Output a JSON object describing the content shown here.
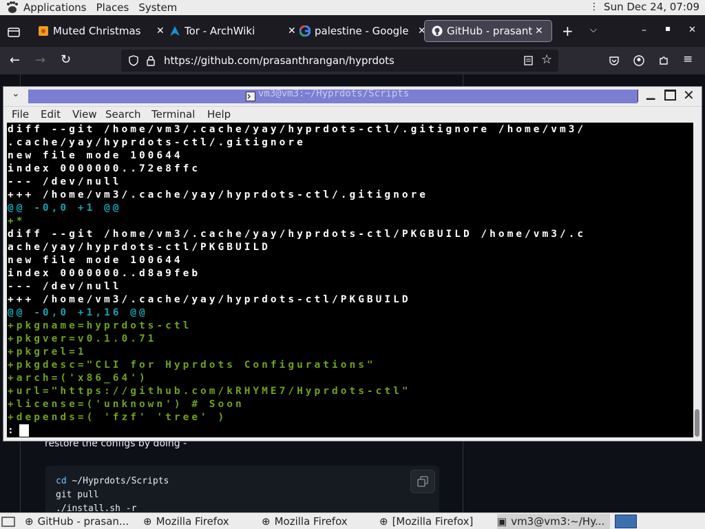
{
  "top_panel": {
    "applications": "Applications",
    "places": "Places",
    "system": "System",
    "clock": "Sun Dec 24, 07:09"
  },
  "browser": {
    "tabs": [
      {
        "label": "Muted Christmas",
        "icon": "christmas-tab-icon"
      },
      {
        "label": "Tor - ArchWiki",
        "icon": "archlinux-icon"
      },
      {
        "label": "palestine - Google",
        "icon": "google-icon"
      },
      {
        "label": "GitHub - prasanth",
        "icon": "github-icon"
      }
    ],
    "url": "https://github.com/prasanthrangan/hyprdots"
  },
  "github_page": {
    "restore_text": "restore the configs by doing -",
    "code_lines": [
      "cd ~/Hyprdots/Scripts",
      "git pull",
      "./install.sh -r"
    ]
  },
  "terminal": {
    "title": "vm3@vm3:~/Hyprdots/Scripts",
    "menu": [
      "File",
      "Edit",
      "View",
      "Search",
      "Terminal",
      "Help"
    ],
    "lines": [
      {
        "text": "diff --git /home/vm3/.cache/yay/hyprdots-ctl/.gitignore /home/vm3/",
        "color": "white"
      },
      {
        "text": ".cache/yay/hyprdots-ctl/.gitignore",
        "color": "white"
      },
      {
        "text": "new file mode 100644",
        "color": "white"
      },
      {
        "text": "index 0000000..72e8ffc",
        "color": "white"
      },
      {
        "text": "--- /dev/null",
        "color": "white"
      },
      {
        "text": "+++ /home/vm3/.cache/yay/hyprdots-ctl/.gitignore",
        "color": "white"
      },
      {
        "text": "@@ -0,0 +1 @@",
        "color": "cyan"
      },
      {
        "text": "+*",
        "color": "green"
      },
      {
        "text": "diff --git /home/vm3/.cache/yay/hyprdots-ctl/PKGBUILD /home/vm3/.c",
        "color": "white"
      },
      {
        "text": "ache/yay/hyprdots-ctl/PKGBUILD",
        "color": "white"
      },
      {
        "text": "new file mode 100644",
        "color": "white"
      },
      {
        "text": "index 0000000..d8a9feb",
        "color": "white"
      },
      {
        "text": "--- /dev/null",
        "color": "white"
      },
      {
        "text": "+++ /home/vm3/.cache/yay/hyprdots-ctl/PKGBUILD",
        "color": "white"
      },
      {
        "text": "@@ -0,0 +1,16 @@",
        "color": "cyan"
      },
      {
        "text": "+pkgname=hyprdots-ctl",
        "color": "green"
      },
      {
        "text": "+pkgver=v0.1.0.71",
        "color": "green"
      },
      {
        "text": "+pkgrel=1",
        "color": "green"
      },
      {
        "text": "+pkgdesc=\"CLI for Hyprdots Configurations\"",
        "color": "green"
      },
      {
        "text": "+arch=('x86_64')",
        "color": "green"
      },
      {
        "text": "+url=\"https://github.com/kRHYME7/Hyprdots-ctl\"",
        "color": "green"
      },
      {
        "text": "+license=('unknown') # Soon",
        "color": "green"
      },
      {
        "text": "+depends=( 'fzf' 'tree' )",
        "color": "green"
      },
      {
        "text": ":",
        "color": "white"
      }
    ]
  },
  "taskbar": {
    "tasks": [
      {
        "label": "GitHub - prasan...",
        "icon": "firefox-icon"
      },
      {
        "label": "Mozilla Firefox",
        "icon": "firefox-icon"
      },
      {
        "label": "Mozilla Firefox",
        "icon": "firefox-icon"
      },
      {
        "label": "[Mozilla Firefox]",
        "icon": "firefox-icon"
      },
      {
        "label": "vm3@vm3:~/Hy...",
        "icon": "terminal-icon"
      }
    ]
  },
  "colors": {
    "terminal_white": "#ffffff",
    "terminal_cyan": "#17a2b0",
    "terminal_green": "#6fa31c",
    "title_bar": "#7a7fd1"
  }
}
